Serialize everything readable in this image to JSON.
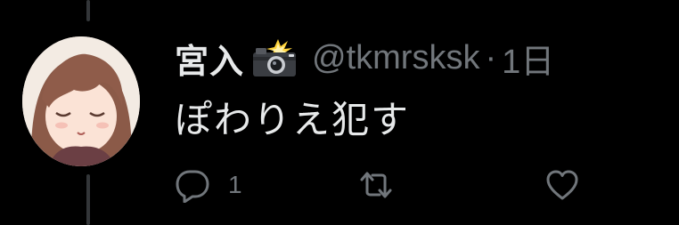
{
  "tweet": {
    "display_name": "宮入",
    "emoji_icon": "camera-with-flash-icon",
    "handle": "@tkmrsksk",
    "separator": "·",
    "time": "1日",
    "text": "ぽわりえ犯す"
  },
  "actions": {
    "reply_icon": "reply-icon",
    "reply_count": "1",
    "retweet_icon": "retweet-icon",
    "like_icon": "like-icon"
  },
  "colors": {
    "background": "#000000",
    "primary_text": "#e7e9ea",
    "secondary_text": "#71767b",
    "thread_line": "#333639"
  }
}
